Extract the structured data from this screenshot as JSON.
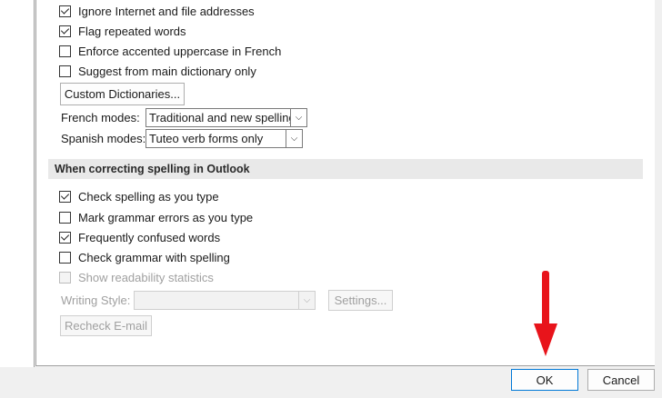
{
  "top_options": [
    {
      "label": "Ignore Internet and file addresses",
      "checked": true
    },
    {
      "label": "Flag repeated words",
      "checked": true
    },
    {
      "label": "Enforce accented uppercase in French",
      "checked": false
    },
    {
      "label": "Suggest from main dictionary only",
      "checked": false
    }
  ],
  "custom_dictionaries_label": "Custom Dictionaries...",
  "french_modes": {
    "label": "French modes:",
    "value": "Traditional and new spellings"
  },
  "spanish_modes": {
    "label": "Spanish modes:",
    "value": "Tuteo verb forms only"
  },
  "section_title": "When correcting spelling in Outlook",
  "outlook_options": [
    {
      "label": "Check spelling as you type",
      "checked": true
    },
    {
      "label": "Mark grammar errors as you type",
      "checked": false
    },
    {
      "label": "Frequently confused words",
      "checked": true
    },
    {
      "label": "Check grammar with spelling",
      "checked": false
    },
    {
      "label": "Show readability statistics",
      "checked": false,
      "disabled": true
    }
  ],
  "writing_style": {
    "label": "Writing Style:",
    "value": ""
  },
  "settings_label": "Settings...",
  "recheck_label": "Recheck E-mail",
  "footer": {
    "ok_label": "OK",
    "cancel_label": "Cancel"
  },
  "annotation_color": "#e8141b",
  "icons": {
    "check": "checkmark-icon",
    "dropdown": "chevron-down-icon",
    "annotation": "red-arrow-icon"
  }
}
